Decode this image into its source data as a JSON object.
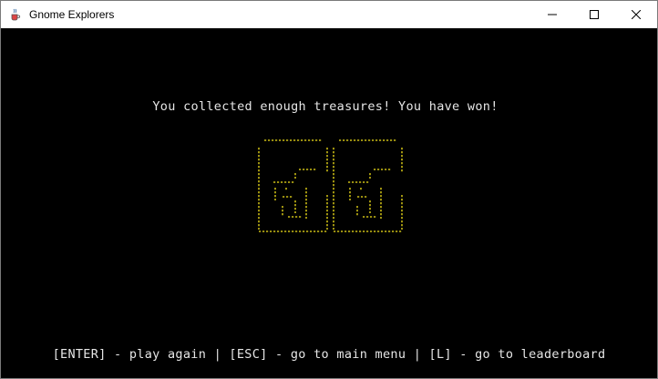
{
  "window": {
    "title": "Gnome Explorers",
    "app_icon": "java-cup-icon",
    "buttons": [
      "minimize-icon",
      "maximize-icon",
      "close-icon"
    ]
  },
  "game": {
    "win_message": "You collected enough treasures! You have won!",
    "logo_text": "GG",
    "logo_color": "#f2e11a",
    "footer_hint": "[ENTER] - play again | [ESC] - go to main menu | [L] - go to leaderboard"
  },
  "colors": {
    "background": "#000000",
    "text": "#e6e6e6",
    "titlebar": "#ffffff"
  }
}
